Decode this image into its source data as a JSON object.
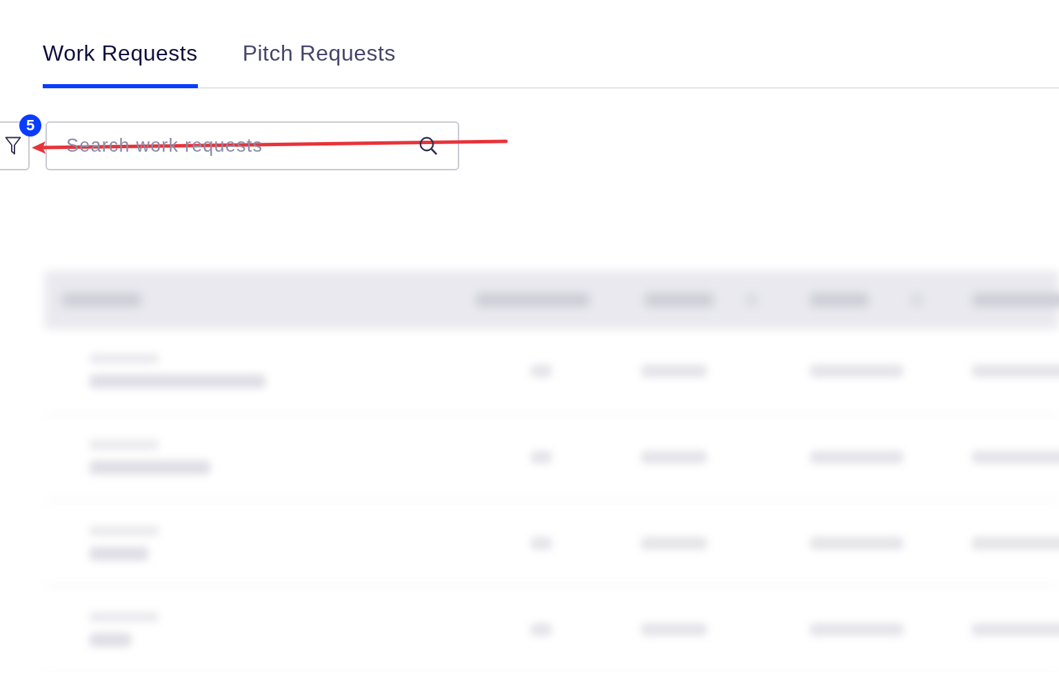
{
  "tabs": [
    {
      "label": "Work Requests",
      "selected": true
    },
    {
      "label": "Pitch Requests",
      "selected": false
    }
  ],
  "toolbar": {
    "filter_button": {
      "badge": "5"
    },
    "search": {
      "placeholder": "Search work requests"
    }
  }
}
